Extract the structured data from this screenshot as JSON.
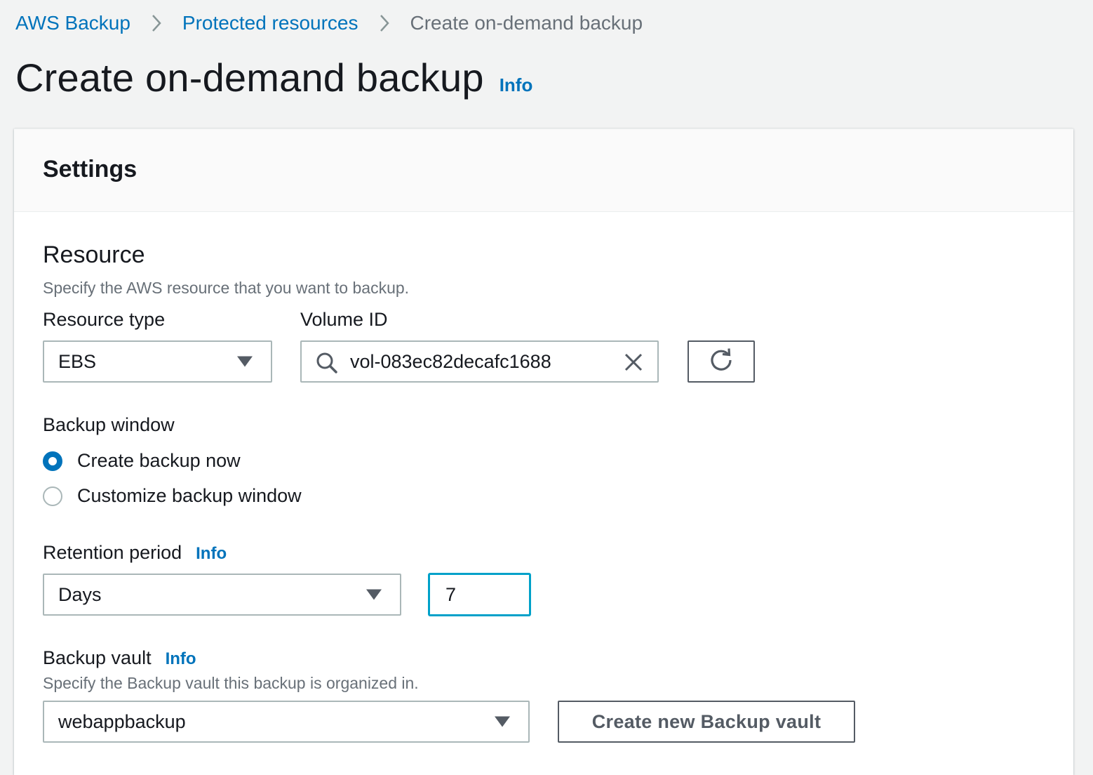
{
  "breadcrumb": {
    "items": [
      "AWS Backup",
      "Protected resources"
    ],
    "current": "Create on-demand backup"
  },
  "page": {
    "title": "Create on-demand backup",
    "info_label": "Info"
  },
  "settings": {
    "title": "Settings",
    "resource": {
      "heading": "Resource",
      "description": "Specify the AWS resource that you want to backup.",
      "resource_type_label": "Resource type",
      "resource_type_value": "EBS",
      "volume_id_label": "Volume ID",
      "volume_id_value": "vol-083ec82decafc1688",
      "icons": [
        "search-icon",
        "clear-icon",
        "refresh-icon"
      ]
    },
    "backup_window": {
      "label": "Backup window",
      "options": [
        "Create backup now",
        "Customize backup window"
      ],
      "selected": "Create backup now"
    },
    "retention": {
      "label": "Retention period",
      "info_label": "Info",
      "unit_value": "Days",
      "amount_value": "7"
    },
    "vault": {
      "label": "Backup vault",
      "info_label": "Info",
      "description": "Specify the Backup vault this backup is organized in.",
      "value": "webappbackup",
      "create_button_label": "Create new Backup vault"
    }
  },
  "colors": {
    "link": "#0073bb",
    "focus": "#00a1c9",
    "background": "#f2f3f3",
    "muted_text": "#687078"
  }
}
